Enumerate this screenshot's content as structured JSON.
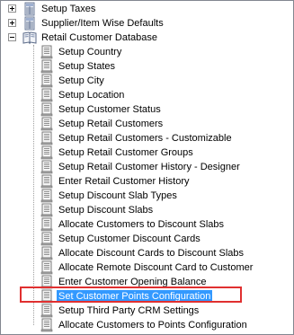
{
  "tree": {
    "top_items": [
      {
        "label": "Setup Taxes",
        "expanded": false,
        "icon": "grid-database-icon"
      },
      {
        "label": "Supplier/Item Wise Defaults",
        "expanded": false,
        "icon": "grid-database-icon"
      },
      {
        "label": "Retail Customer Database",
        "expanded": true,
        "icon": "open-book-icon"
      }
    ],
    "children": [
      {
        "label": "Setup Country"
      },
      {
        "label": "Setup States"
      },
      {
        "label": "Setup City"
      },
      {
        "label": "Setup Location"
      },
      {
        "label": "Setup Customer Status"
      },
      {
        "label": "Setup Retail Customers"
      },
      {
        "label": "Setup Retail Customers - Customizable"
      },
      {
        "label": "Setup Retail Customer Groups"
      },
      {
        "label": "Setup Retail Customer History - Designer"
      },
      {
        "label": "Enter Retail Customer History"
      },
      {
        "label": "Setup Discount Slab Types"
      },
      {
        "label": "Setup Discount Slabs"
      },
      {
        "label": "Allocate Customers to Discount Slabs"
      },
      {
        "label": "Setup Customer Discount Cards"
      },
      {
        "label": "Allocate Discount Cards to Discount Slabs"
      },
      {
        "label": "Allocate Remote Discount Card to Customer"
      },
      {
        "label": "Enter Customer Opening Balance"
      },
      {
        "label": "Set Customer Points Configuration",
        "selected": true
      },
      {
        "label": "Setup Third Party CRM Settings"
      },
      {
        "label": "Allocate Customers to Points Configuration"
      }
    ],
    "child_icon": "document-page-icon",
    "colors": {
      "selection": "#3399ff",
      "highlight_border": "#e03030"
    }
  }
}
